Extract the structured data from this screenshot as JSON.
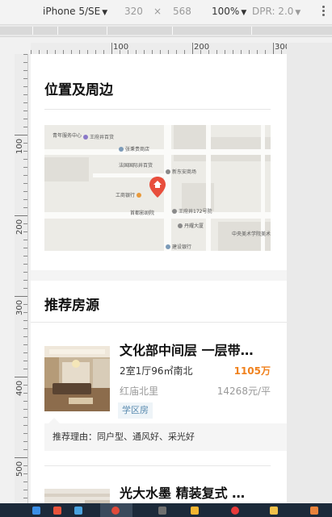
{
  "toolbar": {
    "device": "iPhone 5/SE",
    "width": "320",
    "times": "×",
    "height": "568",
    "zoom": "100%",
    "dpr": "DPR: 2.0"
  },
  "ruler": {
    "h_labels": [
      "100",
      "200",
      "300"
    ],
    "v_labels": [
      "100",
      "200",
      "300",
      "400",
      "500"
    ]
  },
  "location": {
    "title": "位置及周边",
    "map_pois": [
      "青年服务中心",
      "王府井百货",
      "张秉贵商店",
      "法国国际井百货",
      "新东安商场",
      "工商银行",
      "首都影剧院",
      "王府井172号院",
      "丹耀大厦",
      "中央美术学院美术馆",
      "建设银行"
    ]
  },
  "recommend": {
    "title": "推荐房源",
    "listings": [
      {
        "title": "文化部中间层 一层带…",
        "spec": "2室1厅96㎡南北",
        "price": "1105万",
        "area": "红庙北里",
        "unit_price": "14268元/平",
        "tag": "学区房",
        "reason": "推荐理由：同户型、通风好、采光好"
      },
      {
        "title": "光大水墨 精装复式 …"
      }
    ]
  },
  "colors": {
    "price": "#f0811d",
    "pin": "#e84e3c",
    "tag_bg": "#eef4f8",
    "tag_text": "#5a8bb0"
  }
}
